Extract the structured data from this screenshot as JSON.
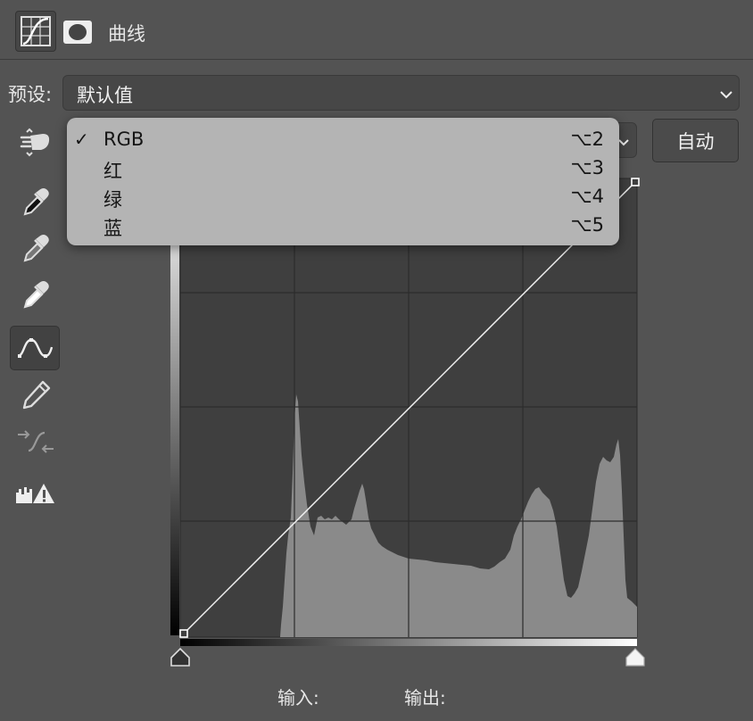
{
  "header": {
    "title": "曲线"
  },
  "preset": {
    "label": "预设:",
    "value": "默认值"
  },
  "auto_button": {
    "label": "自动"
  },
  "channel_menu": {
    "items": [
      {
        "label": "RGB",
        "shortcut": "⌥2",
        "checked": true
      },
      {
        "label": "红",
        "shortcut": "⌥3",
        "checked": false
      },
      {
        "label": "绿",
        "shortcut": "⌥4",
        "checked": false
      },
      {
        "label": "蓝",
        "shortcut": "⌥5",
        "checked": false
      }
    ]
  },
  "check_mark": "✓",
  "io": {
    "input_label": "输入:",
    "output_label": "输出:"
  },
  "colors": {
    "panel_bg": "#535353",
    "graph_bg": "#3f3f3f",
    "histogram": "#8a8a8a",
    "menu_bg": "#b4b4b4"
  }
}
